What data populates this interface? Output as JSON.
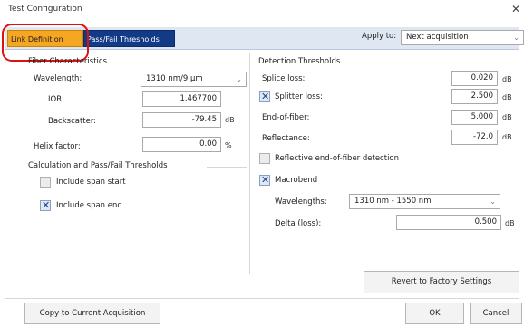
{
  "window": {
    "title": "Test Configuration",
    "close_glyph": "✕"
  },
  "tabs": [
    {
      "label": "Link Definition",
      "active": true
    },
    {
      "label": "Pass/Fail Thresholds",
      "active": false
    }
  ],
  "apply_to": {
    "label": "Apply to:",
    "value": "Next acquisition"
  },
  "fiber": {
    "section_title": "Fiber Characteristics",
    "wavelength_label": "Wavelength:",
    "wavelength_value": "1310 nm/9 µm",
    "ior_label": "IOR:",
    "ior_value": "1.467700",
    "backscatter_label": "Backscatter:",
    "backscatter_value": "-79.45",
    "backscatter_unit": "dB",
    "helix_label": "Helix factor:",
    "helix_value": "0.00",
    "helix_unit": "%"
  },
  "calc": {
    "section_title": "Calculation and Pass/Fail Thresholds",
    "include_start_label": "Include span start",
    "include_start_checked": false,
    "include_end_label": "Include span end",
    "include_end_checked": true
  },
  "detection": {
    "section_title": "Detection Thresholds",
    "splice_label": "Splice loss:",
    "splice_value": "0.020",
    "splice_unit": "dB",
    "splitter_label": "Splitter loss:",
    "splitter_checked": true,
    "splitter_value": "2.500",
    "splitter_unit": "dB",
    "eof_label": "End-of-fiber:",
    "eof_value": "5.000",
    "eof_unit": "dB",
    "reflectance_label": "Reflectance:",
    "reflectance_value": "-72.0",
    "reflectance_unit": "dB",
    "reflective_eof_label": "Reflective end-of-fiber detection",
    "reflective_eof_checked": false,
    "macrobend_label": "Macrobend",
    "macrobend_checked": true,
    "wavelengths_label": "Wavelengths:",
    "wavelengths_value": "1310 nm - 1550 nm",
    "delta_label": "Delta (loss):",
    "delta_value": "0.500",
    "delta_unit": "dB"
  },
  "buttons": {
    "revert": "Revert to Factory Settings",
    "copy": "Copy to Current Acquisition",
    "ok": "OK",
    "cancel": "Cancel"
  },
  "colors": {
    "tab_active": "#f5a623",
    "tab_inactive": "#123a87",
    "highlight": "#e11010"
  }
}
